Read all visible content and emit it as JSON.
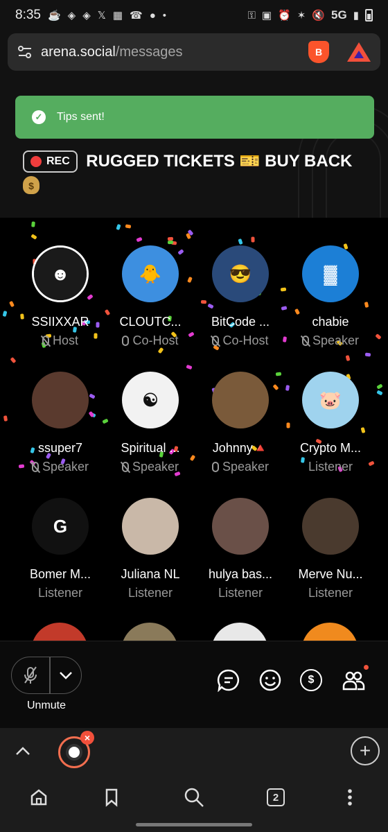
{
  "status_bar": {
    "time": "8:35",
    "network": "5G"
  },
  "browser": {
    "url_domain": "arena.social",
    "url_path": "/messages",
    "shield_label": "B"
  },
  "toast": {
    "text": "Tips sent!"
  },
  "space": {
    "rec_label": "REC",
    "title": "RUGGED TICKETS 🎫 BUY BACK",
    "title_emoji": "$"
  },
  "participants": [
    {
      "name": "SSIIXXAR",
      "role": "Host",
      "mic": "off",
      "color": "#1a1a1a",
      "initial": "☻"
    },
    {
      "name": "CLOUTC...",
      "role": "Co-Host",
      "mic": "on",
      "color": "#3d8fe0",
      "initial": "🐥"
    },
    {
      "name": "BitCode ...",
      "role": "Co-Host",
      "mic": "off",
      "color": "#2a4a7a",
      "initial": "😎"
    },
    {
      "name": "chabie",
      "role": "Speaker",
      "mic": "off",
      "color": "#1c7fd6",
      "initial": "▓"
    },
    {
      "name": "ssuper7",
      "role": "Speaker",
      "mic": "off",
      "color": "#5a3a2e",
      "initial": ""
    },
    {
      "name": "Spiritual ...",
      "role": "Speaker",
      "mic": "off",
      "color": "#f2f2f2",
      "initial": "☯"
    },
    {
      "name": "Johnny🔺",
      "role": "Speaker",
      "mic": "on",
      "color": "#7a5a3a",
      "initial": ""
    },
    {
      "name": "Crypto M...",
      "role": "Listener",
      "mic": "",
      "color": "#9fd3ee",
      "initial": "🐷"
    },
    {
      "name": "Bomer M...",
      "role": "Listener",
      "mic": "",
      "color": "#111111",
      "initial": "G"
    },
    {
      "name": "Juliana NL",
      "role": "Listener",
      "mic": "",
      "color": "#c9b8a8",
      "initial": ""
    },
    {
      "name": "hulya bas...",
      "role": "Listener",
      "mic": "",
      "color": "#6a5048",
      "initial": ""
    },
    {
      "name": "Merve Nu...",
      "role": "Listener",
      "mic": "",
      "color": "#4a3a2e",
      "initial": ""
    }
  ],
  "controls": {
    "unmute_label": "Unmute"
  },
  "tabs": {
    "count": "2"
  },
  "icons": {
    "mic_muted": "mic-off-icon",
    "chevron": "chevron-down-icon",
    "chat": "chat-icon",
    "emoji": "emoji-icon",
    "tip": "dollar-icon",
    "people": "people-icon",
    "home": "home-icon",
    "bookmark": "bookmark-icon",
    "search": "search-icon",
    "menu": "more-icon"
  },
  "colors": {
    "toast_bg": "#55ad5f",
    "rec_dot": "#f03d3d",
    "accent": "#f2503b"
  }
}
